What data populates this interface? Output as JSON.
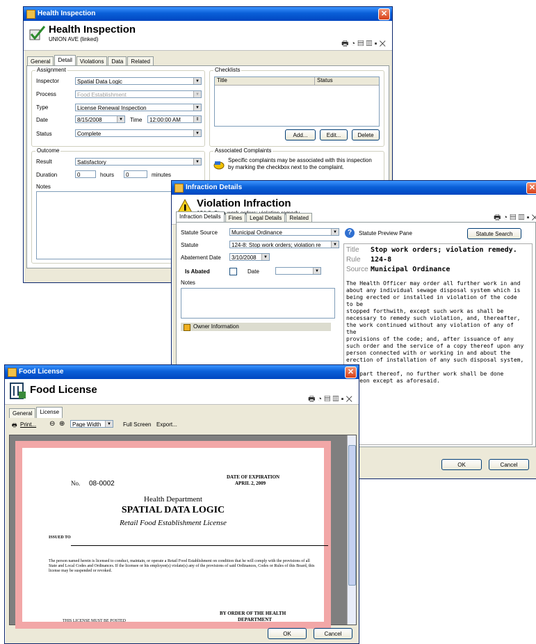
{
  "health": {
    "window_title": "Health Inspection",
    "title": "Health Inspection",
    "subtitle": "UNION AVE (linked)",
    "tabs": [
      "General",
      "Detail",
      "Violations",
      "Data",
      "Related"
    ],
    "assignment": {
      "label": "Assignment",
      "inspector_label": "Inspector",
      "inspector_value": "Spatial Data Logic",
      "process_label": "Process",
      "process_value": "Food Establishment",
      "type_label": "Type",
      "type_value": "License Renewal Inspection",
      "date_label": "Date",
      "date_value": "8/15/2008",
      "time_label": "Time",
      "time_value": "12:00:00 AM",
      "status_label": "Status",
      "status_value": "Complete"
    },
    "checklists": {
      "label": "Checklists",
      "col_title": "Title",
      "col_status": "Status",
      "add": "Add...",
      "edit": "Edit...",
      "delete": "Delete"
    },
    "outcome": {
      "label": "Outcome",
      "result_label": "Result",
      "result_value": "Satisfactory",
      "duration_label": "Duration",
      "hours_value": "0",
      "hours_label": "hours",
      "minutes_value": "0",
      "minutes_label": "minutes",
      "notes_label": "Notes"
    },
    "complaints": {
      "label": "Associated Complaints",
      "text": "Specific complaints may be associated with this inspection by marking the checkbox next to the complaint."
    }
  },
  "infraction": {
    "window_title": "Infraction Details",
    "title": "Violation Infraction",
    "subtitle": "124-8: Stop work orders; violation remedy.",
    "tabs": [
      "Infraction Details",
      "Fines",
      "Legal Details",
      "Related"
    ],
    "statute_source_label": "Statute Source",
    "statute_source_value": "Municipal Ordinance",
    "statute_label": "Statute",
    "statute_value": "124-8: Stop work orders; violation re",
    "abatement_label": "Abatement Date",
    "abatement_value": "3/10/2008",
    "is_abated_label": "Is Abated",
    "date_label": "Date",
    "notes_label": "Notes",
    "owner_info": "Owner Information",
    "preview_label": "Statute Preview Pane",
    "statute_search": "Statute Search",
    "title_label": "Title",
    "title_value": "Stop work orders; violation remedy.",
    "rule_label": "Rule",
    "rule_value": "124-8",
    "source_label": "Source",
    "source_value": "Municipal Ordinance",
    "body_lines": [
      "The Health Officer may order all further work in and",
      "about any individual sewage disposal system which is",
      "being erected or installed in violation of the code to be",
      "stopped forthwith, except such work as shall be",
      "necessary to remedy such violation, and, thereafter,",
      "the work continued without any violation of any of the",
      "provisions of the code; and, after issuance of any",
      "such order and the service of a copy thereof upon any",
      "person connected with or working in and about the",
      "erection of installation of any such disposal system, or",
      "any part thereof, no further work shall be done",
      "thereon except as aforesaid."
    ],
    "ok": "OK",
    "cancel": "Cancel"
  },
  "food": {
    "window_title": "Food License",
    "title": "Food License",
    "tabs": [
      "General",
      "License"
    ],
    "toolbar": {
      "print": "Print...",
      "zoom": "Page Width",
      "full_screen": "Full Screen",
      "export": "Export..."
    },
    "cert": {
      "no_label": "No.",
      "no_value": "08-0002",
      "expiration_label": "DATE OF EXPIRATION",
      "expiration_value": "APRIL 2, 2009",
      "dept": "Health Department",
      "company": "SPATIAL DATA LOGIC",
      "license_type": "Retail Food Establishment License",
      "issued_to": "ISSUED TO",
      "body": "The person named herein is licensed to conduct, maintain, or operate a Retail Food Establishment on condition that he will comply with the provisions of all State and Local Codes and Ordinances. If the licensee or his employee(s) violate(s) any of the provisions of said Ordinances, Codes or Rules of this Board, this license may be suspended or revoked.",
      "must_post": "THIS LICENSE MUST BE POSTED",
      "order_line1": "BY ORDER OF THE HEALTH",
      "order_line2": "DEPARTMENT"
    },
    "ok": "OK",
    "cancel": "Cancel"
  }
}
